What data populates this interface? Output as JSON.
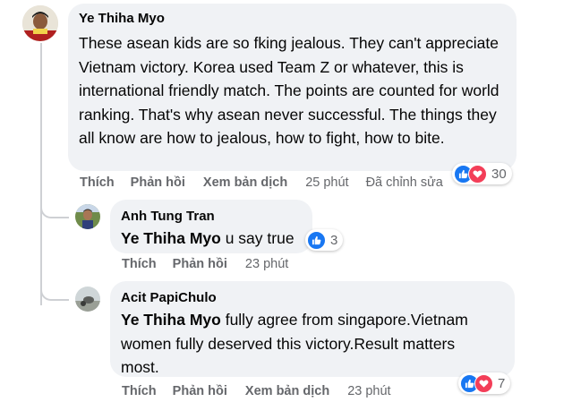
{
  "comments": [
    {
      "author": "Ye Thiha Myo",
      "text": "These asean kids are so fking jealous. They can't appreciate Vietnam victory. Korea used Team Z or whatever, this is international friendly match. The points are counted for world ranking. That's why asean never successful. The things they all know are how to jealous, how to fight, how to bite.",
      "actions": {
        "like": "Thích",
        "reply": "Phản hồi",
        "translate": "Xem bản dịch"
      },
      "time": "25 phút",
      "edited": "Đã chỉnh sửa",
      "reactions": {
        "icons": [
          "like-icon",
          "love-icon"
        ],
        "count": "30"
      }
    },
    {
      "author": "Anh Tung Tran",
      "mention": "Ye Thiha Myo",
      "text": "u say true",
      "actions": {
        "like": "Thích",
        "reply": "Phản hồi"
      },
      "time": "23 phút",
      "reactions": {
        "icons": [
          "like-icon"
        ],
        "count": "3"
      }
    },
    {
      "author": "Acit PapiChulo",
      "mention": "Ye Thiha Myo",
      "text_line1": "fully agree from singapore.Vietnam",
      "text_rest": "women fully deserved this victory.Result matters most.",
      "actions": {
        "like": "Thích",
        "reply": "Phản hồi",
        "translate": "Xem bản dịch"
      },
      "time": "23 phút",
      "reactions": {
        "icons": [
          "like-icon",
          "love-icon"
        ],
        "count": "7"
      }
    }
  ],
  "colors": {
    "like": "#1877f2",
    "love": "#f33e58",
    "bubble": "#f0f2f5",
    "meta": "#65676b"
  }
}
